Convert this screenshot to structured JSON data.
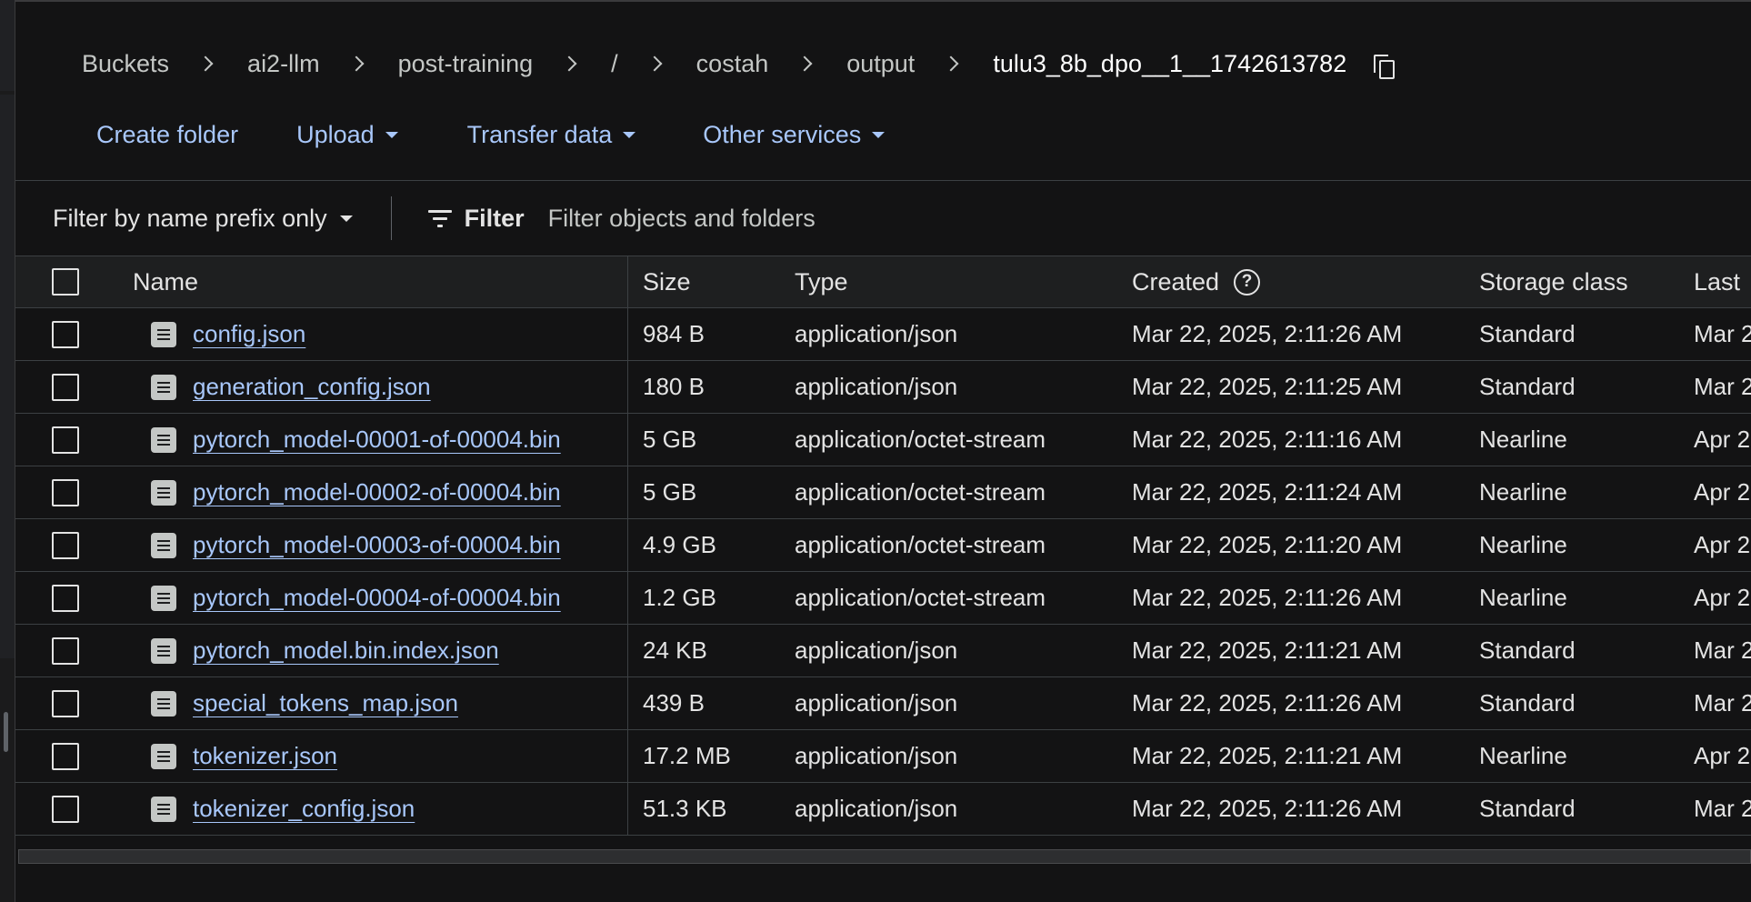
{
  "breadcrumb": [
    "Buckets",
    "ai2-llm",
    "post-training",
    "/",
    "costah",
    "output",
    "tulu3_8b_dpo__1__1742613782"
  ],
  "toolbar": {
    "create_folder": "Create folder",
    "upload": "Upload",
    "transfer_data": "Transfer data",
    "other_services": "Other services"
  },
  "filter": {
    "mode": "Filter by name prefix only",
    "label": "Filter",
    "placeholder": "Filter objects and folders"
  },
  "table": {
    "columns": {
      "name": "Name",
      "size": "Size",
      "type": "Type",
      "created": "Created",
      "storage_class": "Storage class",
      "last": "Last"
    },
    "rows": [
      {
        "name": "config.json",
        "size": "984 B",
        "type": "application/json",
        "created": "Mar 22, 2025, 2:11:26 AM",
        "storage": "Standard",
        "last": "Mar 2"
      },
      {
        "name": "generation_config.json",
        "size": "180 B",
        "type": "application/json",
        "created": "Mar 22, 2025, 2:11:25 AM",
        "storage": "Standard",
        "last": "Mar 2"
      },
      {
        "name": "pytorch_model-00001-of-00004.bin",
        "size": "5 GB",
        "type": "application/octet-stream",
        "created": "Mar 22, 2025, 2:11:16 AM",
        "storage": "Nearline",
        "last": "Apr 2"
      },
      {
        "name": "pytorch_model-00002-of-00004.bin",
        "size": "5 GB",
        "type": "application/octet-stream",
        "created": "Mar 22, 2025, 2:11:24 AM",
        "storage": "Nearline",
        "last": "Apr 2"
      },
      {
        "name": "pytorch_model-00003-of-00004.bin",
        "size": "4.9 GB",
        "type": "application/octet-stream",
        "created": "Mar 22, 2025, 2:11:20 AM",
        "storage": "Nearline",
        "last": "Apr 2"
      },
      {
        "name": "pytorch_model-00004-of-00004.bin",
        "size": "1.2 GB",
        "type": "application/octet-stream",
        "created": "Mar 22, 2025, 2:11:26 AM",
        "storage": "Nearline",
        "last": "Apr 2"
      },
      {
        "name": "pytorch_model.bin.index.json",
        "size": "24 KB",
        "type": "application/json",
        "created": "Mar 22, 2025, 2:11:21 AM",
        "storage": "Standard",
        "last": "Mar 2"
      },
      {
        "name": "special_tokens_map.json",
        "size": "439 B",
        "type": "application/json",
        "created": "Mar 22, 2025, 2:11:26 AM",
        "storage": "Standard",
        "last": "Mar 2"
      },
      {
        "name": "tokenizer.json",
        "size": "17.2 MB",
        "type": "application/json",
        "created": "Mar 22, 2025, 2:11:21 AM",
        "storage": "Nearline",
        "last": "Apr 2"
      },
      {
        "name": "tokenizer_config.json",
        "size": "51.3 KB",
        "type": "application/json",
        "created": "Mar 22, 2025, 2:11:26 AM",
        "storage": "Standard",
        "last": "Mar 2"
      }
    ]
  },
  "icons": {
    "breadcrumb_separator": "chevron-right-icon",
    "copy_path": "copy-icon",
    "dropdown": "caret-down-icon",
    "filter": "filter-icon",
    "created_help": "help-icon",
    "row_file": "file-icon"
  },
  "colors": {
    "background": "#131314",
    "link": "#a8c7fa",
    "text": "#e3e3e3",
    "header_bg": "#1e1f20",
    "border": "#3c4043"
  }
}
